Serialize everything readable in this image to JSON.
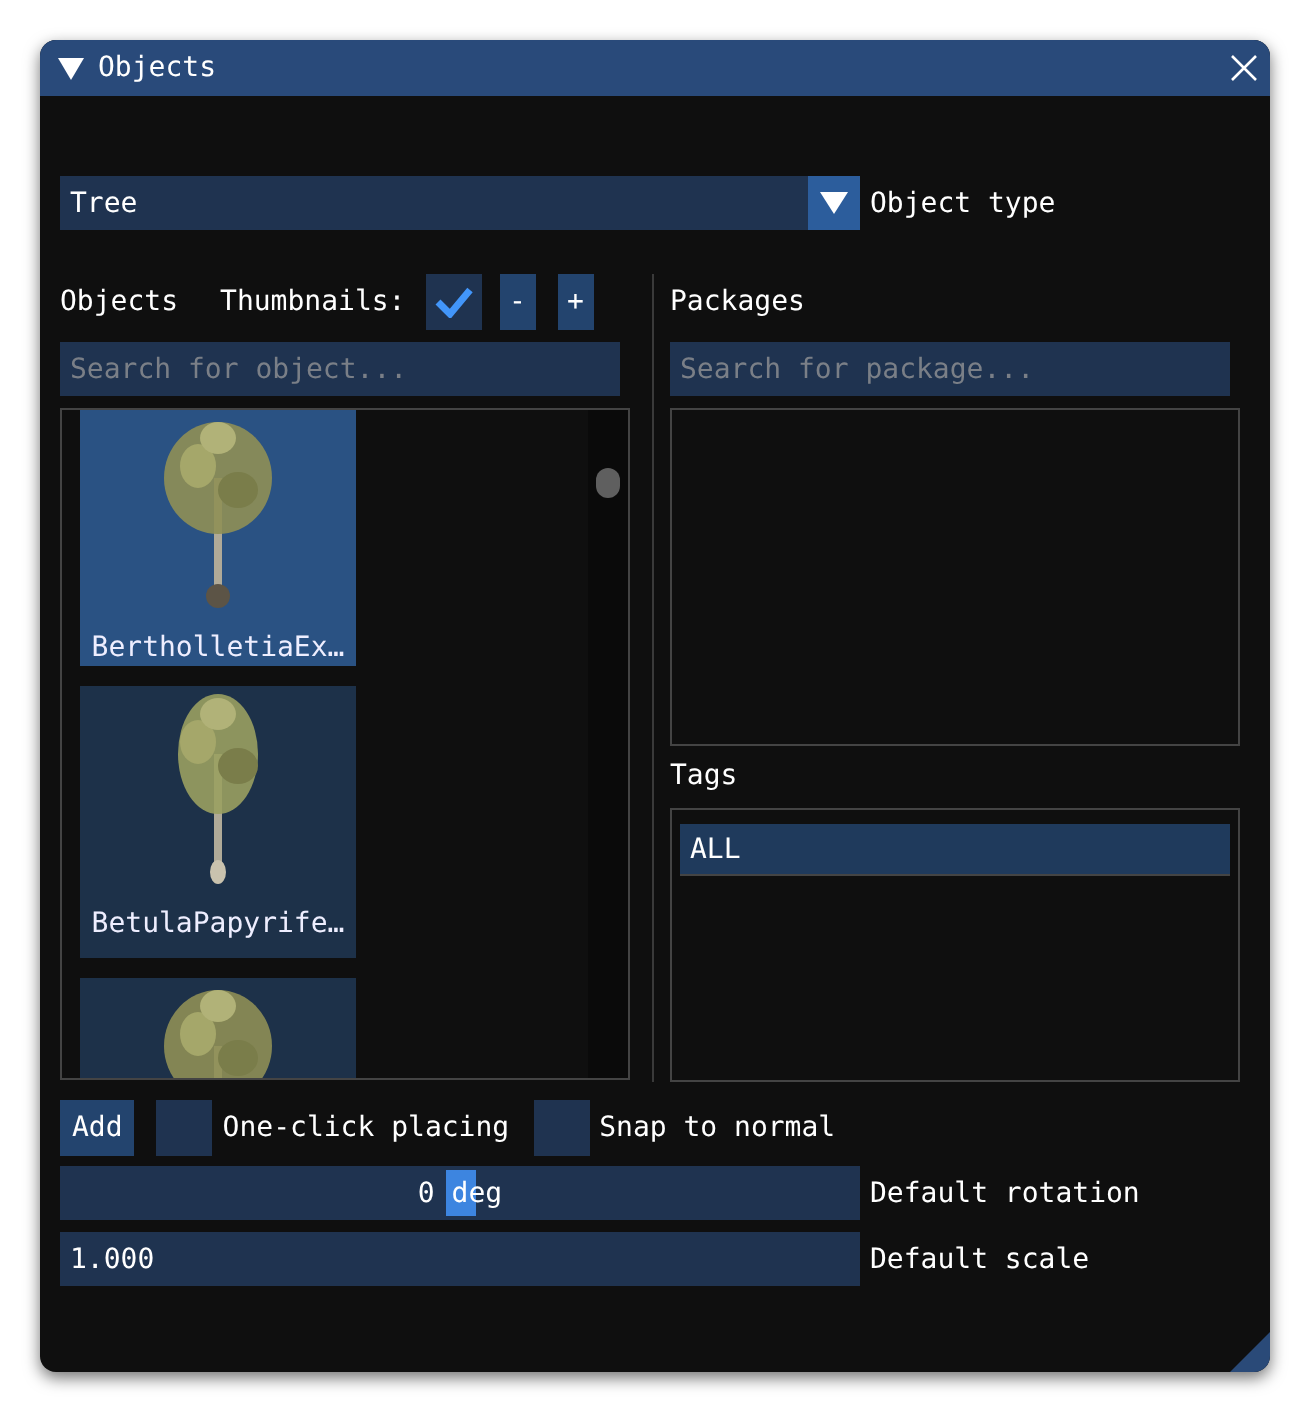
{
  "window": {
    "title": "Objects"
  },
  "object_type": {
    "value": "Tree",
    "label": "Object type"
  },
  "objects": {
    "label": "Objects",
    "thumbnails_label": "Thumbnails:",
    "thumbnails_checked": true,
    "minus": "-",
    "plus": "+",
    "search": {
      "placeholder": "Search for object..."
    },
    "items": [
      {
        "label": "BertholletiaEx…",
        "selected": true
      },
      {
        "label": "BetulaPapyrife…",
        "selected": false
      },
      {
        "selected": false
      }
    ]
  },
  "packages": {
    "label": "Packages",
    "search": {
      "placeholder": "Search for package..."
    }
  },
  "tags": {
    "label": "Tags",
    "items": [
      {
        "label": "ALL",
        "selected": true
      }
    ]
  },
  "add_button": "Add",
  "options": [
    {
      "label": "One-click placing",
      "checked": false
    },
    {
      "label": "Snap to normal",
      "checked": false
    }
  ],
  "rotation": {
    "value": "0 deg",
    "level": 0.5,
    "label": "Default rotation"
  },
  "scale": {
    "value": "1.000",
    "label": "Default scale"
  }
}
